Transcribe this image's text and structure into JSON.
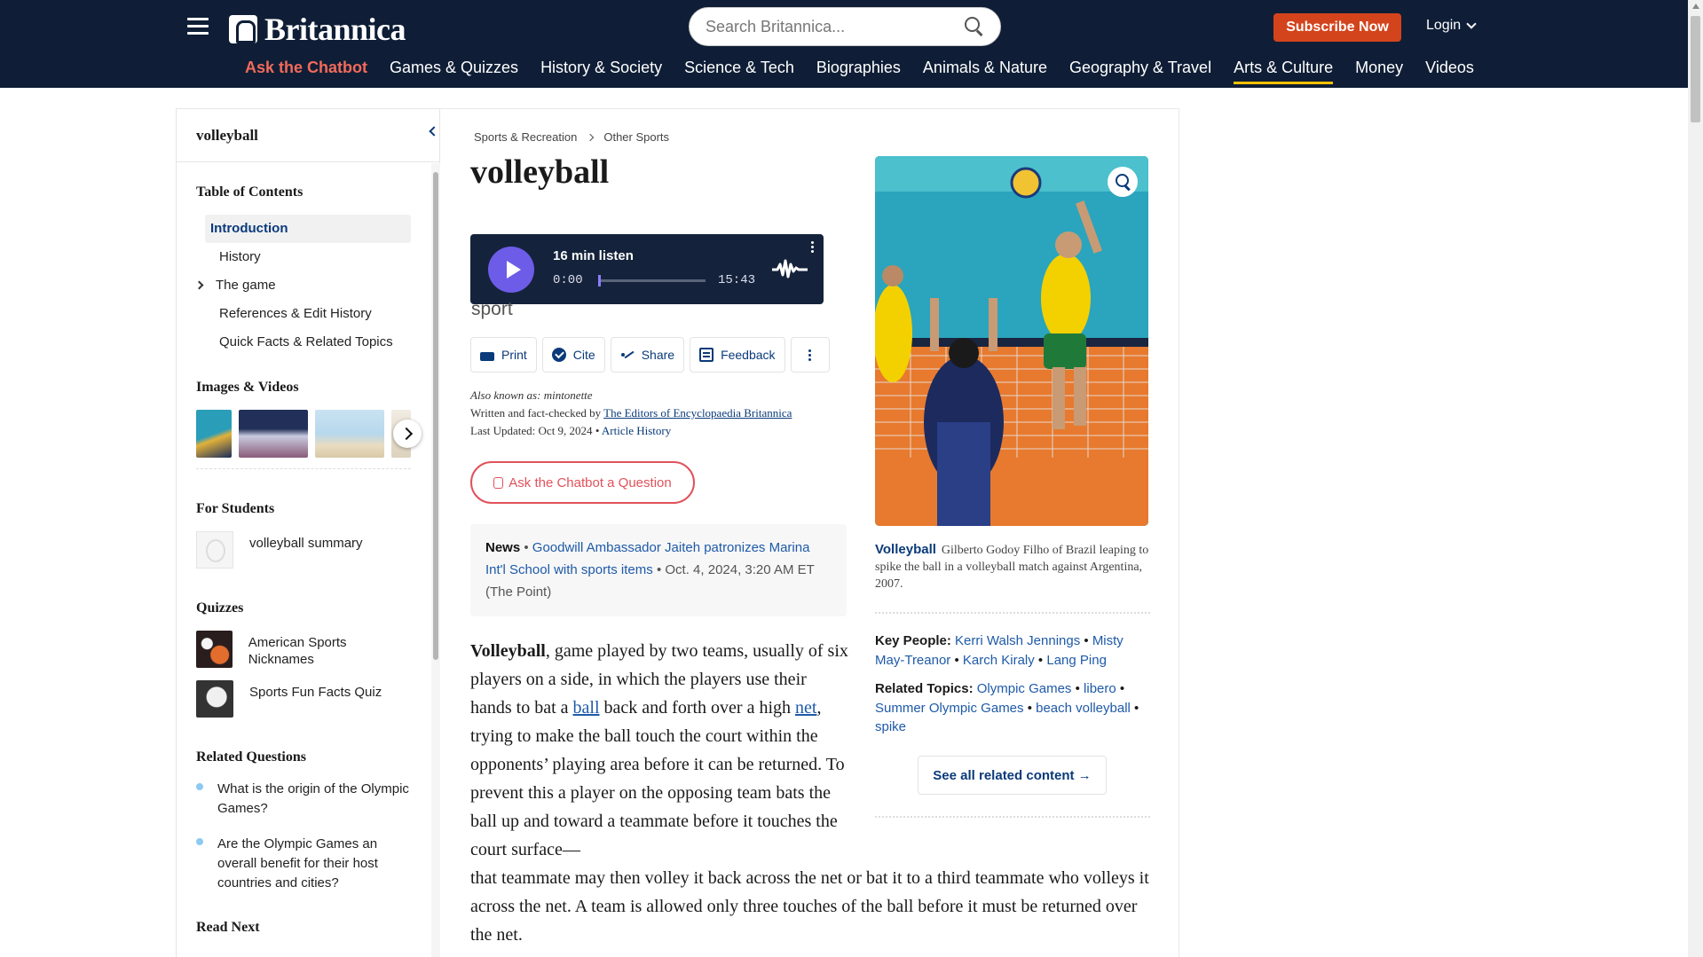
{
  "header": {
    "logo_text": "Britannica",
    "search_placeholder": "Search Britannica...",
    "subscribe_label": "Subscribe Now",
    "login_label": "Login",
    "nav": [
      {
        "label": "Ask the Chatbot"
      },
      {
        "label": "Games & Quizzes"
      },
      {
        "label": "History & Society"
      },
      {
        "label": "Science & Tech"
      },
      {
        "label": "Biographies"
      },
      {
        "label": "Animals & Nature"
      },
      {
        "label": "Geography & Travel"
      },
      {
        "label": "Arts & Culture"
      },
      {
        "label": "Money"
      },
      {
        "label": "Videos"
      }
    ],
    "active_nav": "Arts & Culture",
    "colors": {
      "header_bg": "#0f1e36",
      "subscribe_bg": "#d3441c",
      "chatbot_link": "#f26a5a",
      "active_underline": "#f5c000"
    }
  },
  "sidebar": {
    "title": "volleyball",
    "toc_title": "Table of Contents",
    "toc": [
      {
        "label": "Introduction"
      },
      {
        "label": "History"
      },
      {
        "label": "The game"
      },
      {
        "label": "References & Edit History"
      },
      {
        "label": "Quick Facts & Related Topics"
      }
    ],
    "images_title": "Images & Videos",
    "students_title": "For Students",
    "students": [
      {
        "label": "volleyball summary"
      }
    ],
    "quizzes_title": "Quizzes",
    "quizzes": [
      {
        "label": "American Sports Nicknames"
      },
      {
        "label": "Sports Fun Facts Quiz"
      }
    ],
    "related_q_title": "Related Questions",
    "related_questions": [
      {
        "label": "What is the origin of the Olympic Games?"
      },
      {
        "label": "Are the Olympic Games an overall benefit for their host countries and cities?"
      }
    ],
    "read_next_title": "Read Next"
  },
  "article": {
    "breadcrumb": [
      "Sports & Recreation",
      "Other Sports"
    ],
    "title": "volleyball",
    "audio": {
      "label": "16 min listen",
      "current": "0:00",
      "total": "15:43",
      "progress": 0
    },
    "subtitle": "sport",
    "tools": {
      "print": "Print",
      "cite": "Cite",
      "share": "Share",
      "feedback": "Feedback"
    },
    "aka": "Also known as: mintonette",
    "written_prefix": "Written and fact-checked by",
    "written_by": "The Editors of Encyclopaedia Britannica",
    "updated_prefix": "Last Updated: Oct 9, 2024",
    "article_history": "Article History",
    "ask_button": "Ask the Chatbot a Question",
    "news": {
      "label": "News",
      "headline": "Goodwill Ambassador Jaiteh patronizes Marina Int'l School with sports items",
      "date": "Oct. 4, 2024, 3:20 AM ET",
      "source": "(The Point)"
    },
    "body": {
      "bold": "Volleyball",
      "t1": ", game played by two teams, usually of six players on a side, in which the players use their hands to bat a ",
      "link1": "ball",
      "t2": " back and forth over a high ",
      "link2": "net",
      "t3": ", trying to make the ball touch the court within the opponents’ playing area before it can be returned. To prevent this a player on the opposing team bats the ball up and toward a teammate before it touches the court surface—",
      "t4": "that teammate may then volley it back across the net or bat it to a third teammate who volleys it across the net. A team is allowed only three touches of the ball before it must be returned over the net."
    }
  },
  "aside": {
    "caption_title": "Volleyball",
    "caption_text": "Gilberto Godoy Filho of Brazil leaping to spike the ball in a volleyball match against Argentina, 2007.",
    "key_people_label": "Key People:",
    "key_people": [
      "Kerri Walsh Jennings",
      "Misty May-Treanor",
      "Karch Kiraly",
      "Lang Ping"
    ],
    "related_topics_label": "Related Topics:",
    "related_topics": [
      "Olympic Games",
      "libero",
      "Summer Olympic Games",
      "beach volleyball",
      "spike"
    ],
    "see_all": "See all related content →"
  }
}
